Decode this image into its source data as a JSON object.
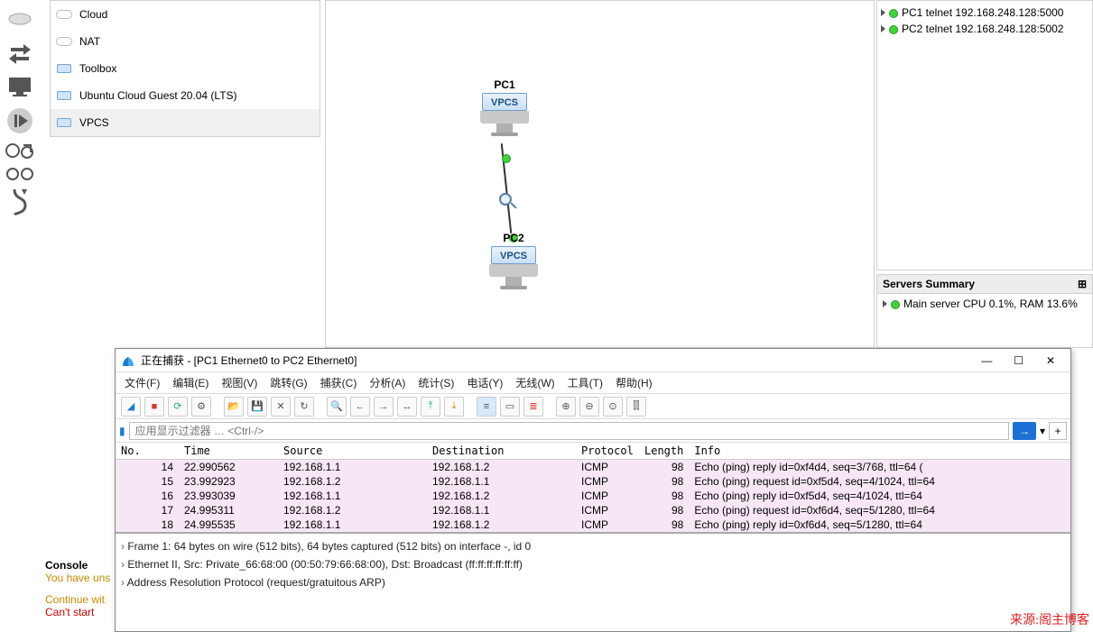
{
  "devices": {
    "cloud": "Cloud",
    "nat": "NAT",
    "toolbox": "Toolbox",
    "ubuntu": "Ubuntu Cloud Guest 20.04 (LTS)",
    "vpcs": "VPCS"
  },
  "canvas": {
    "pc1": "PC1",
    "pc2": "PC2",
    "vpcs": "VPCS"
  },
  "topo": {
    "pc1": "PC1 telnet 192.168.248.128:5000",
    "pc2": "PC2 telnet 192.168.248.128:5002"
  },
  "servers": {
    "title": "Servers Summary",
    "main": "Main server CPU 0.1%, RAM 13.6%"
  },
  "console": {
    "title": "Console",
    "l1": "You have uns",
    "l2": "Continue wit",
    "l3": "Can't start"
  },
  "ws": {
    "title": "正在捕获 - [PC1 Ethernet0 to PC2 Ethernet0]",
    "menu": {
      "file": "文件(F)",
      "edit": "编辑(E)",
      "view": "视图(V)",
      "go": "跳转(G)",
      "capture": "捕获(C)",
      "analyze": "分析(A)",
      "stats": "统计(S)",
      "tele": "电话(Y)",
      "wireless": "无线(W)",
      "tools": "工具(T)",
      "help": "帮助(H)"
    },
    "filter_ph": "应用显示过滤器 … <Ctrl-/>",
    "cols": {
      "no": "No.",
      "time": "Time",
      "src": "Source",
      "dst": "Destination",
      "proto": "Protocol",
      "len": "Length",
      "info": "Info"
    },
    "rows": [
      {
        "no": "14",
        "time": "22.990562",
        "src": "192.168.1.1",
        "dst": "192.168.1.2",
        "proto": "ICMP",
        "len": "98",
        "info": "Echo (ping) reply   id=0xf4d4, seq=3/768, ttl=64 ("
      },
      {
        "no": "15",
        "time": "23.992923",
        "src": "192.168.1.2",
        "dst": "192.168.1.1",
        "proto": "ICMP",
        "len": "98",
        "info": "Echo (ping) request id=0xf5d4, seq=4/1024, ttl=64"
      },
      {
        "no": "16",
        "time": "23.993039",
        "src": "192.168.1.1",
        "dst": "192.168.1.2",
        "proto": "ICMP",
        "len": "98",
        "info": "Echo (ping) reply   id=0xf5d4, seq=4/1024, ttl=64"
      },
      {
        "no": "17",
        "time": "24.995311",
        "src": "192.168.1.2",
        "dst": "192.168.1.1",
        "proto": "ICMP",
        "len": "98",
        "info": "Echo (ping) request id=0xf6d4, seq=5/1280, ttl=64"
      },
      {
        "no": "18",
        "time": "24.995535",
        "src": "192.168.1.1",
        "dst": "192.168.1.2",
        "proto": "ICMP",
        "len": "98",
        "info": "Echo (ping) reply   id=0xf6d4, seq=5/1280, ttl=64"
      }
    ],
    "details": {
      "d1": "Frame 1: 64 bytes on wire (512 bits), 64 bytes captured (512 bits) on interface -, id 0",
      "d2": "Ethernet II, Src: Private_66:68:00 (00:50:79:66:68:00), Dst: Broadcast (ff:ff:ff:ff:ff:ff)",
      "d3": "Address Resolution Protocol (request/gratuitous ARP)"
    }
  },
  "watermark": "来源:阁主博客"
}
